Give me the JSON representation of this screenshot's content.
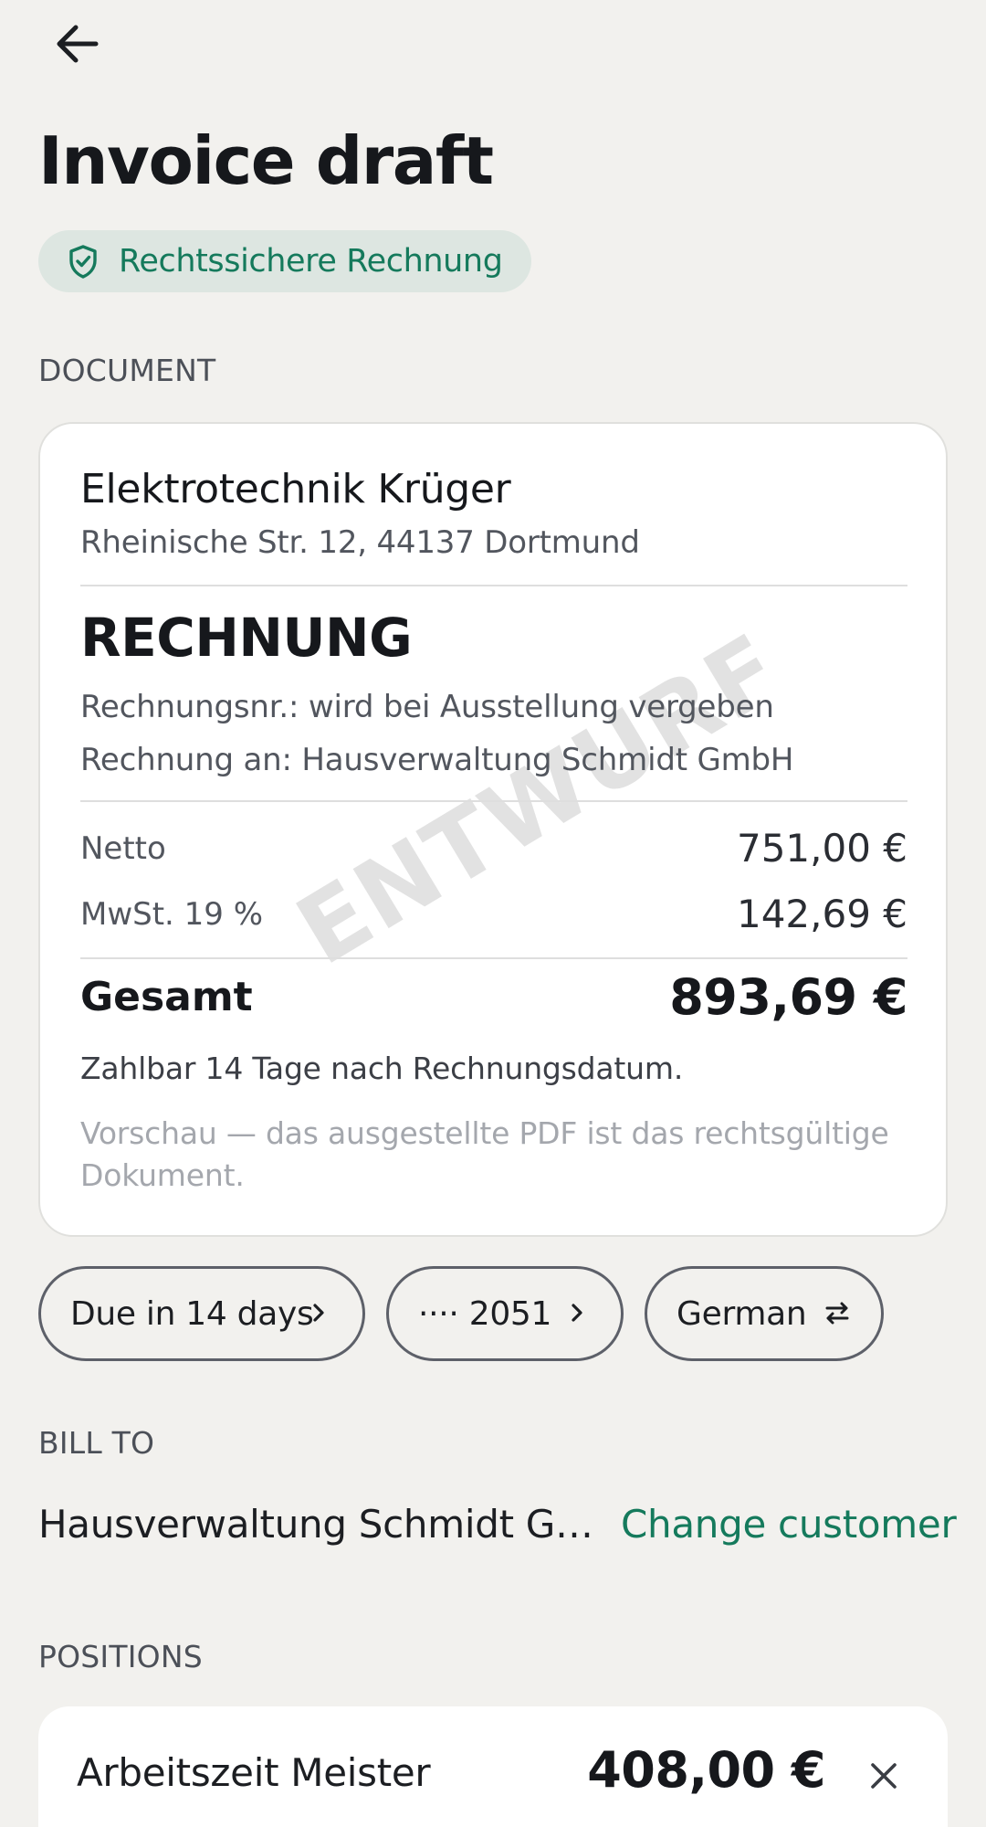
{
  "header": {
    "back_icon": "arrow-left-icon",
    "title": "Invoice draft",
    "badge": {
      "icon": "shield-check-icon",
      "label": "Rechtssichere Rechnung"
    }
  },
  "document_section": {
    "label": "DOCUMENT",
    "preview": {
      "company_name": "Elektrotechnik Krüger",
      "company_address": "Rheinische Str. 12, 44137 Dortmund",
      "heading": "RECHNUNG",
      "invoice_number": "Rechnungsnr.: wird bei Ausstellung vergeben",
      "bill_to": "Rechnung an: Hausverwaltung Schmidt GmbH",
      "net_label": "Netto",
      "net_value": "751,00 €",
      "vat_label": "MwSt. 19 %",
      "vat_value": "142,69 €",
      "total_label": "Gesamt",
      "total_value": "893,69 €",
      "payment_terms": "Zahlbar 14 Tage nach Rechnungsdatum.",
      "preview_note": "Vorschau — das ausgestellte PDF ist das rechtsgültige Dokument.",
      "watermark": "ENTWURF"
    }
  },
  "chips": [
    {
      "label": "Due in 14 days",
      "icon": "chevron-right-icon"
    },
    {
      "label": "···· 2051",
      "icon": "chevron-right-icon"
    },
    {
      "label": "German",
      "icon": "swap-arrows-icon"
    }
  ],
  "bill_to_section": {
    "label": "BILL TO",
    "customer_name": "Hausverwaltung Schmidt GmbH",
    "change_label": "Change customer"
  },
  "positions_section": {
    "label": "POSITIONS",
    "items": [
      {
        "name": "Arbeitszeit Meister",
        "amount": "408,00 €",
        "remove_icon": "close-icon"
      }
    ]
  },
  "colors": {
    "background": "#f2f1ee",
    "accent_green": "#157a5c",
    "badge_bg": "#dde6e1",
    "card_bg": "#ffffff"
  }
}
